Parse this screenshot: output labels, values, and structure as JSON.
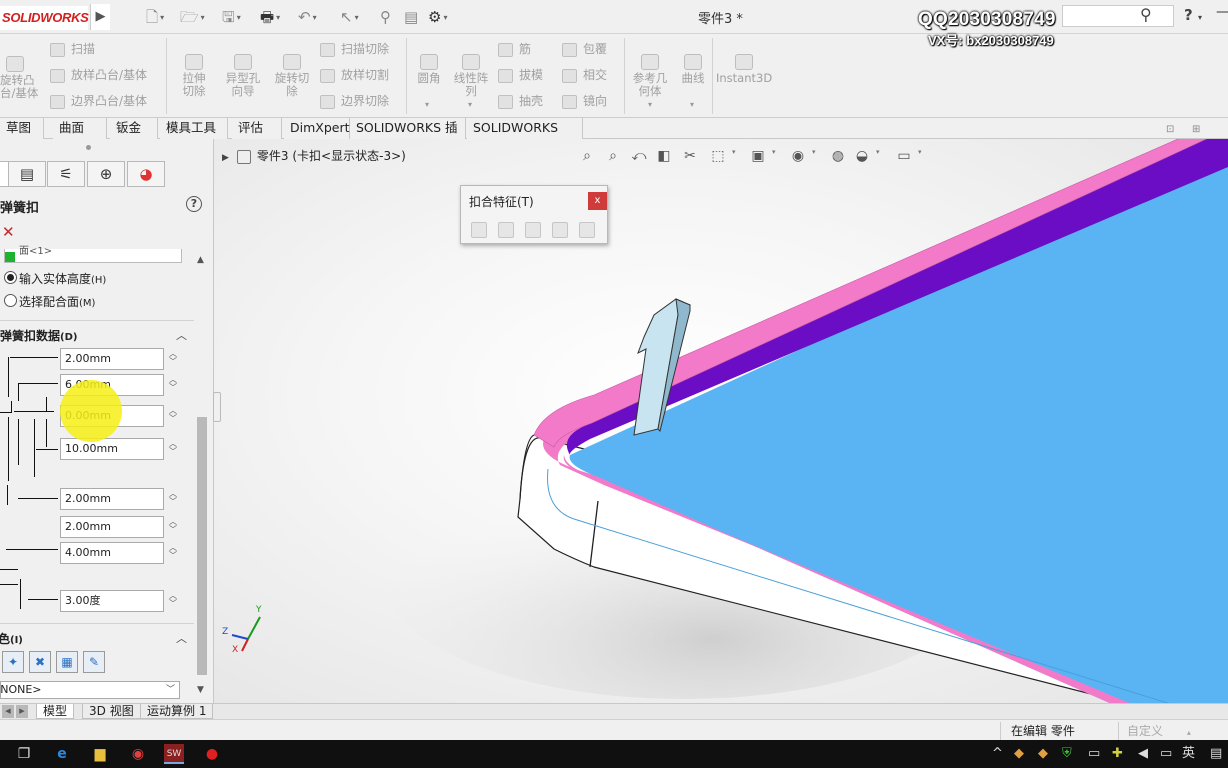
{
  "titlebar": {
    "logo_text": "SOLIDWORKS",
    "document_title": "零件3 *",
    "watermark_line1": "QQ2030308749",
    "watermark_line2": "VX号: bx2030308749"
  },
  "command_manager": {
    "partial_left": {
      "line1": "旋转凸",
      "line2": "台/基体"
    },
    "sweep_group": [
      "扫描",
      "放样凸台/基体",
      "边界凸台/基体"
    ],
    "extrude_cut": "拉伸切除",
    "hole_wizard": "异型孔向导",
    "revolve_cut": "旋转切除",
    "cut_group": [
      "扫描切除",
      "放样切割",
      "边界切除"
    ],
    "fillet": "圆角",
    "linear_pattern": "线性阵列",
    "rib_group": [
      "筋",
      "拔模",
      "抽壳"
    ],
    "wrap_group": [
      "包覆",
      "相交",
      "镜向"
    ],
    "ref_geometry": "参考几何体",
    "curves": "曲线",
    "instant3d": "Instant3D"
  },
  "tabs": [
    "草图",
    "曲面",
    "钣金",
    "模具工具",
    "评估",
    "DimXpert",
    "SOLIDWORKS 插件",
    "SOLIDWORKS MBD"
  ],
  "property_manager": {
    "title": "弹簧扣",
    "partial_selection": "面<1>",
    "options": [
      {
        "label": "输入实体高度",
        "shortcut": "(H)",
        "selected": true
      },
      {
        "label": "选择配合面",
        "shortcut": "(M)",
        "selected": false
      }
    ],
    "data_section_title": "弹簧扣数据",
    "data_section_shortcut": "(D)",
    "fields": [
      "2.00mm",
      "6.00mm",
      "0.00mm",
      "10.00mm",
      "2.00mm",
      "2.00mm",
      "4.00mm",
      "3.00度"
    ],
    "bottom_section_title": "颜色",
    "bottom_section_shortcut": "(I)",
    "dropdown_value": "<NONE>"
  },
  "viewport": {
    "breadcrumb": "零件3  (卡扣<显示状态-3>)",
    "axis_labels": [
      "Y",
      "Z",
      "X"
    ]
  },
  "dialog": {
    "title": "扣合特征(T)",
    "close": "x"
  },
  "bottom_tabs": [
    "模型",
    "3D 视图",
    "运动算例 1"
  ],
  "status": {
    "mode": "在编辑 零件",
    "units": "自定义"
  },
  "taskbar": {
    "lang": "英"
  },
  "colors": {
    "body_top": "#5ab4f4",
    "wall_purple": "#6b0dc4",
    "wall_pink": "#f27ac8",
    "snap_hook": "#c8e4f0",
    "highlight": "#f6ee14"
  }
}
